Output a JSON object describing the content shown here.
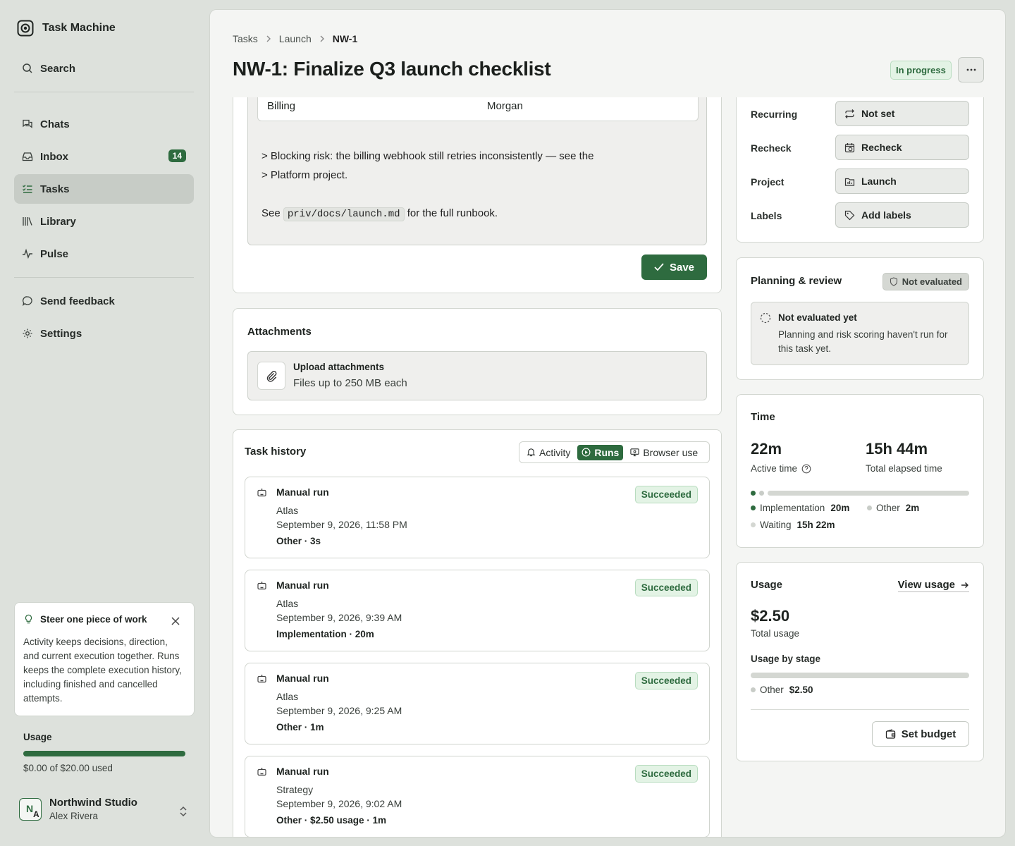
{
  "app": {
    "name": "Task Machine"
  },
  "sidebar": {
    "search_label": "Search",
    "items": [
      {
        "label": "Chats",
        "icon": "chat-icon"
      },
      {
        "label": "Inbox",
        "icon": "inbox-icon",
        "badge": "14"
      },
      {
        "label": "Tasks",
        "icon": "tasks-icon",
        "active": true
      },
      {
        "label": "Library",
        "icon": "library-icon"
      },
      {
        "label": "Pulse",
        "icon": "pulse-icon"
      }
    ],
    "feedback_label": "Send feedback",
    "settings_label": "Settings",
    "tip": {
      "title": "Steer one piece of work",
      "body": "Activity keeps decisions, direction, and current execution together. Runs keeps the complete execution history, including finished and cancelled attempts."
    },
    "usage": {
      "label": "Usage",
      "text": "$0.00 of $20.00 used",
      "fraction": 1.0
    },
    "workspace": {
      "name": "Northwind Studio",
      "user": "Alex Rivera",
      "avatar_n": "N",
      "avatar_a": "A"
    }
  },
  "header": {
    "breadcrumb": [
      "Tasks",
      "Launch",
      "NW-1"
    ],
    "title": "NW-1: Finalize Q3 launch checklist",
    "status": "In progress",
    "more_label": "···"
  },
  "description": {
    "table_row": [
      "Billing",
      "Morgan"
    ],
    "quote_line1": "> Blocking risk: the billing webhook still retries inconsistently — see the",
    "quote_line2": "> Platform project.",
    "see_prefix": "See",
    "see_code": "priv/docs/launch.md",
    "see_suffix": "for the full runbook.",
    "save_label": "Save"
  },
  "attachments": {
    "title": "Attachments",
    "upload_title": "Upload attachments",
    "upload_sub": "Files up to 250 MB each"
  },
  "history": {
    "title": "Task history",
    "tabs": [
      "Activity",
      "Runs",
      "Browser use"
    ],
    "active_tab": "Runs",
    "runs": [
      {
        "title": "Manual run",
        "agent": "Atlas",
        "date": "September 9, 2026, 11:58 PM",
        "meta": "Other · 3s",
        "status": "Succeeded"
      },
      {
        "title": "Manual run",
        "agent": "Atlas",
        "date": "September 9, 2026, 9:39 AM",
        "meta": "Implementation · 20m",
        "status": "Succeeded"
      },
      {
        "title": "Manual run",
        "agent": "Atlas",
        "date": "September 9, 2026, 9:25 AM",
        "meta": "Other · 1m",
        "status": "Succeeded"
      },
      {
        "title": "Manual run",
        "agent": "Strategy",
        "date": "September 9, 2026, 9:02 AM",
        "meta": "Other · $2.50 usage · 1m",
        "status": "Succeeded"
      }
    ]
  },
  "properties": [
    {
      "label": "Recurring",
      "value": "Not set",
      "icon": "repeat-icon"
    },
    {
      "label": "Recheck",
      "value": "Recheck",
      "icon": "calendar-clock-icon"
    },
    {
      "label": "Project",
      "value": "Launch",
      "icon": "project-folder-icon"
    },
    {
      "label": "Labels",
      "value": "Add labels",
      "icon": "tag-icon"
    }
  ],
  "planning": {
    "title": "Planning & review",
    "badge": "Not evaluated",
    "box_title": "Not evaluated yet",
    "box_desc": "Planning and risk scoring haven't run for this task yet."
  },
  "time": {
    "title": "Time",
    "active_value": "22m",
    "active_label": "Active time",
    "total_value": "15h 44m",
    "total_label": "Total elapsed time",
    "legend": [
      {
        "label": "Implementation",
        "value": "20m",
        "color": "#2e6b3f"
      },
      {
        "label": "Other",
        "value": "2m",
        "color": "#c8ccc7"
      },
      {
        "label": "Waiting",
        "value": "15h 22m",
        "color": "#d4d7d2"
      }
    ]
  },
  "usage": {
    "title": "Usage",
    "view_label": "View usage",
    "total_value": "$2.50",
    "total_label": "Total usage",
    "by_stage_label": "Usage by stage",
    "stages": [
      {
        "label": "Other",
        "value": "$2.50",
        "color": "#c8ccc7"
      }
    ],
    "budget_label": "Set budget"
  },
  "colors": {
    "accent": "#2e6b3f",
    "success_bg": "#e3f3e5"
  }
}
